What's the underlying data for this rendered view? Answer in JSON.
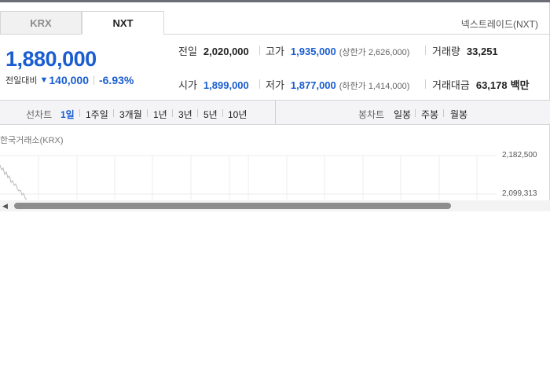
{
  "tabs": [
    {
      "label": "KRX",
      "active": false
    },
    {
      "label": "NXT",
      "active": true
    }
  ],
  "exchange_link": "넥스트레이드(NXT)",
  "price": {
    "current": "1,880,000",
    "change_label": "전일대비",
    "change_direction": "down",
    "change_value": "140,000",
    "change_percent": "-6.93%",
    "color_down": "#1a5dd0"
  },
  "stats": {
    "prev_close": {
      "label": "전일",
      "value": "2,020,000"
    },
    "high": {
      "label": "고가",
      "value": "1,935,000",
      "limit": "(상한가 2,626,000)"
    },
    "volume": {
      "label": "거래량",
      "value": "33,251"
    },
    "open": {
      "label": "시가",
      "value": "1,899,000"
    },
    "low": {
      "label": "저가",
      "value": "1,877,000",
      "limit": "(하한가 1,414,000)"
    },
    "amount": {
      "label": "거래대금",
      "value": "63,178",
      "unit": "백만"
    }
  },
  "toolbar": {
    "line_label": "선차트",
    "line_periods": [
      "1일",
      "1주일",
      "3개월",
      "1년",
      "3년",
      "5년",
      "10년"
    ],
    "active_period": "1일",
    "candle_label": "봉차트",
    "candle_periods": [
      "일봉",
      "주봉",
      "월봉"
    ]
  },
  "chart": {
    "title": "한국거래소(KRX)",
    "y_ticks": [
      "2,182,500",
      "2,099,313"
    ]
  }
}
